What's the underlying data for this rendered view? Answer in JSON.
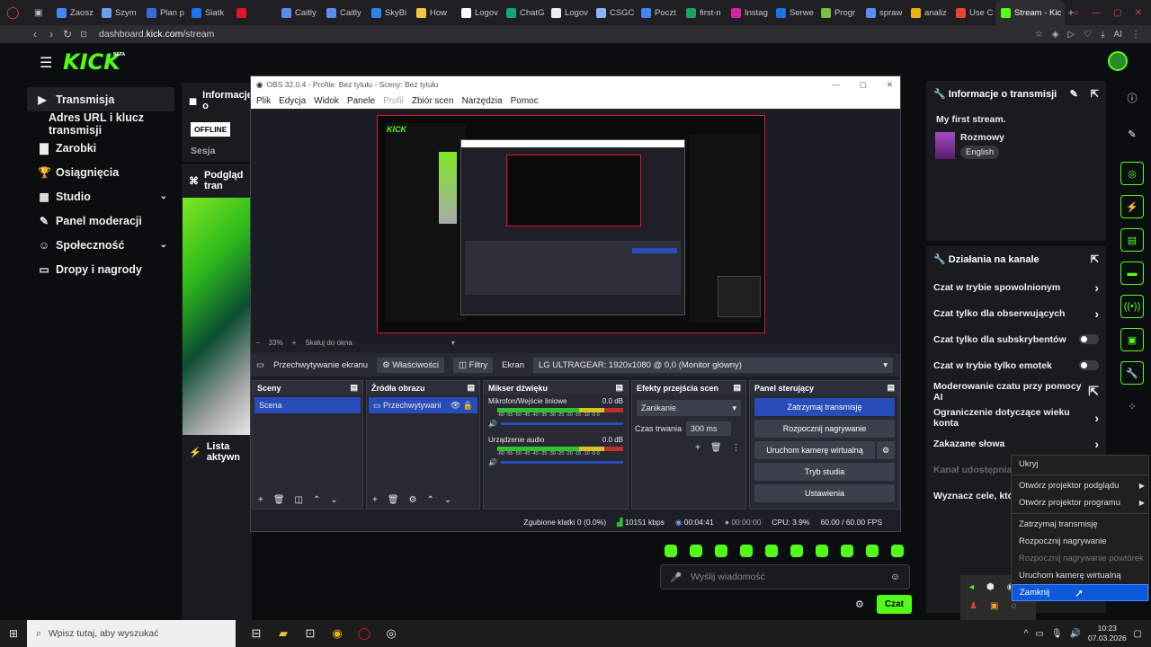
{
  "browser": {
    "tabs": [
      "Zaosz",
      "Szym",
      "Plan p",
      "Siatk",
      "",
      "Caitly",
      "Caitly",
      "SkyBi",
      "How",
      "Logov",
      "ChatG",
      "Logov",
      "CSGC",
      "Poczt",
      "first-n",
      "Instag",
      "Serwe",
      "Progr",
      "spraw",
      "analiz",
      "Use C"
    ],
    "active_tab": "Stream - Kic",
    "url_host": "dashboard.",
    "url_domain": "kick.com",
    "url_path": "/stream",
    "ai_label": "AI"
  },
  "kick": {
    "logo": "KICK",
    "beta": "BETA",
    "sidebar": [
      {
        "label": "Transmisja",
        "icon": "▶"
      },
      {
        "label": "Adres URL i klucz transmisji",
        "icon": ""
      },
      {
        "label": "Zarobki",
        "icon": "▇"
      },
      {
        "label": "Osiągnięcia",
        "icon": "🏆"
      },
      {
        "label": "Studio",
        "icon": "▦"
      },
      {
        "label": "Panel moderacji",
        "icon": "✎"
      },
      {
        "label": "Społeczność",
        "icon": "☺"
      },
      {
        "label": "Dropy i nagrody",
        "icon": "▭"
      }
    ],
    "info_header": "Informacje o",
    "offline": "OFFLINE",
    "session": "Sesja",
    "preview_header": "Podgląd tran",
    "activity_header": "Lista aktywn",
    "stream_info_header": "Informacje o transmisji",
    "stream_title": "My first stream.",
    "category": "Rozmowy",
    "language": "English",
    "channel_actions_header": "Działania na kanale",
    "actions": [
      {
        "label": "Czat w trybie spowolnionym",
        "kind": "arrow"
      },
      {
        "label": "Czat tylko dla obserwujących",
        "kind": "arrow"
      },
      {
        "label": "Czat tylko dla subskrybentów",
        "kind": "toggle"
      },
      {
        "label": "Czat w trybie tylko emotek",
        "kind": "toggle"
      },
      {
        "label": "Moderowanie czatu przy pomocy AI",
        "kind": "link"
      },
      {
        "label": "Ograniczenie dotyczące wieku konta",
        "kind": "arrow"
      },
      {
        "label": "Zakazane słowa",
        "kind": "arrow"
      }
    ],
    "share_label": "Kanał udostępniaj",
    "goals_label": "Wyznacz cele, któr",
    "chat_placeholder": "Wyślij wiadomość",
    "chat_button": "Czat"
  },
  "obs": {
    "title": "OBS 32.0.4 - Profile: Bez tytułu - Sceny: Bez tytułu",
    "menu": [
      "Plik",
      "Edycja",
      "Widok",
      "Panele",
      "Profil",
      "Zbiór scen",
      "Narzędzia",
      "Pomoc"
    ],
    "zoom": "33%",
    "scale_label": "Skaluj do okna",
    "source_name": "Przechwytywanie ekranu",
    "properties_btn": "Właściwości",
    "filters_btn": "Filtry",
    "screen_label": "Ekran",
    "monitor": "LG ULTRAGEAR: 1920x1080 @ 0,0 (Monitor główny)",
    "docks": {
      "scenes": {
        "title": "Sceny",
        "items": [
          "Scena"
        ]
      },
      "sources": {
        "title": "Źródła obrazu",
        "items": [
          "Przechwytywani"
        ]
      },
      "mixer": {
        "title": "Mikser dźwięku",
        "channels": [
          {
            "name": "Mikrofon/Wejście liniowe",
            "db": "0.0 dB"
          },
          {
            "name": "Urządzenie audio",
            "db": "0.0 dB"
          }
        ],
        "scale": "-60 -55 -50 -45 -40 -35 -30 -25 -20 -15 -10 -5 0"
      },
      "transitions": {
        "title": "Efekty przejścia scen",
        "selected": "Zanikanie",
        "duration_label": "Czas trwania",
        "duration": "300 ms"
      },
      "controls": {
        "title": "Panel sterujący",
        "buttons": [
          "Zatrzymaj transmisję",
          "Rozpocznij nagrywanie",
          "Uruchom kamerę wirtualną",
          "Tryb studia",
          "Ustawienia"
        ]
      }
    },
    "status": {
      "dropped": "Zgubione klatki 0 (0.0%)",
      "kbps": "10151 kbps",
      "live": "00:04:41",
      "rec": "00:00:00",
      "cpu": "CPU: 3.9%",
      "fps": "60.00 / 60.00 FPS"
    }
  },
  "context_menu": [
    {
      "label": "Ukryj"
    },
    {
      "label": "Otwórz projektor podglądu",
      "arrow": true
    },
    {
      "label": "Otwórz projektor programu",
      "arrow": true
    },
    {
      "label": "Zatrzymaj transmisję"
    },
    {
      "label": "Rozpocznij nagrywanie"
    },
    {
      "label": "Rozpocznij nagrywanie powtórek",
      "disabled": true
    },
    {
      "label": "Uruchom kamerę wirtualną"
    },
    {
      "label": "Zamknij",
      "selected": true
    }
  ],
  "taskbar": {
    "search_placeholder": "Wpisz tutaj, aby wyszukać",
    "time": "10:23",
    "date": "07.03.2026"
  },
  "colors": {
    "accent": "#53fc18",
    "obs_red": "#e0142a",
    "obs_blue": "#284cb8"
  }
}
